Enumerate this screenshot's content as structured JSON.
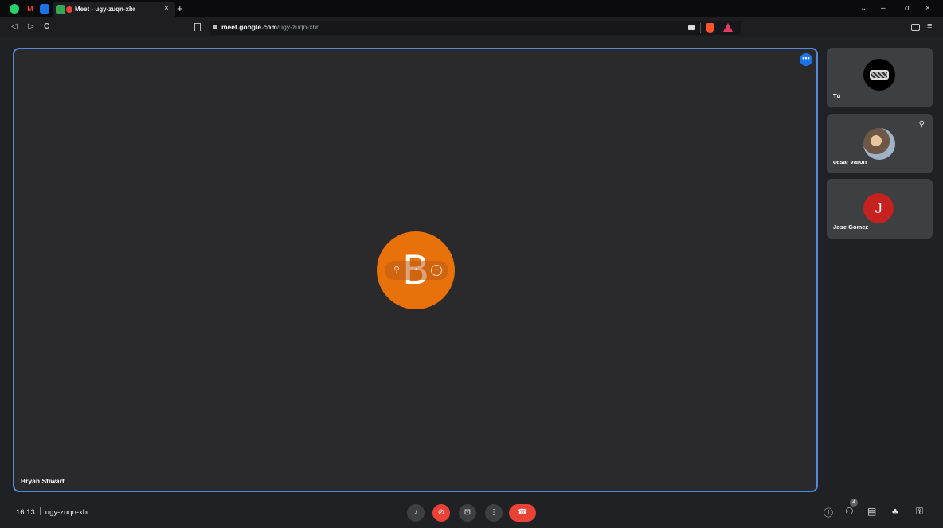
{
  "browser": {
    "tab_title": "Meet - ugy-zuqn-xbr",
    "new_tab_glyph": "+",
    "tab_close_glyph": "×",
    "tab_icons": [
      "whatsapp-icon",
      "gmail-icon",
      "calendar-icon",
      "meet-icon"
    ],
    "window_controls": [
      "⌄",
      "–",
      "σ",
      "×"
    ],
    "nav": {
      "back": "◁",
      "forward": "▷",
      "reload": "C"
    },
    "url_host": "meet.google.com",
    "url_path": "/ugy-zuqn-xbr",
    "menu_glyph": "≡"
  },
  "meeting": {
    "code": "ugy-zuqn-xbr",
    "time": "16:13",
    "main_speaker": {
      "name": "Bryan Stiwart",
      "initial": "B",
      "avatar_color": "#e8710a",
      "more_glyph": "•••"
    },
    "participants": [
      {
        "name": "Tú",
        "avatar": "logo-image"
      },
      {
        "name": "cesar varon",
        "avatar": "photo",
        "muted": true
      },
      {
        "name": "Jose Gomez",
        "initial": "J",
        "avatar_color": "#c5221f"
      }
    ],
    "people_count": "4"
  },
  "controls": {
    "mic": "mic-icon",
    "camera": "camera-off-icon",
    "present": "present-icon",
    "more": "more-vert-icon",
    "end_call": "end-call-icon",
    "right": [
      "info-icon",
      "people-icon",
      "chat-icon",
      "activities-icon",
      "host-controls-icon"
    ]
  },
  "colors": {
    "accent": "#1a73e8",
    "danger": "#ea4335",
    "tile_border": "#4f8bd6"
  }
}
